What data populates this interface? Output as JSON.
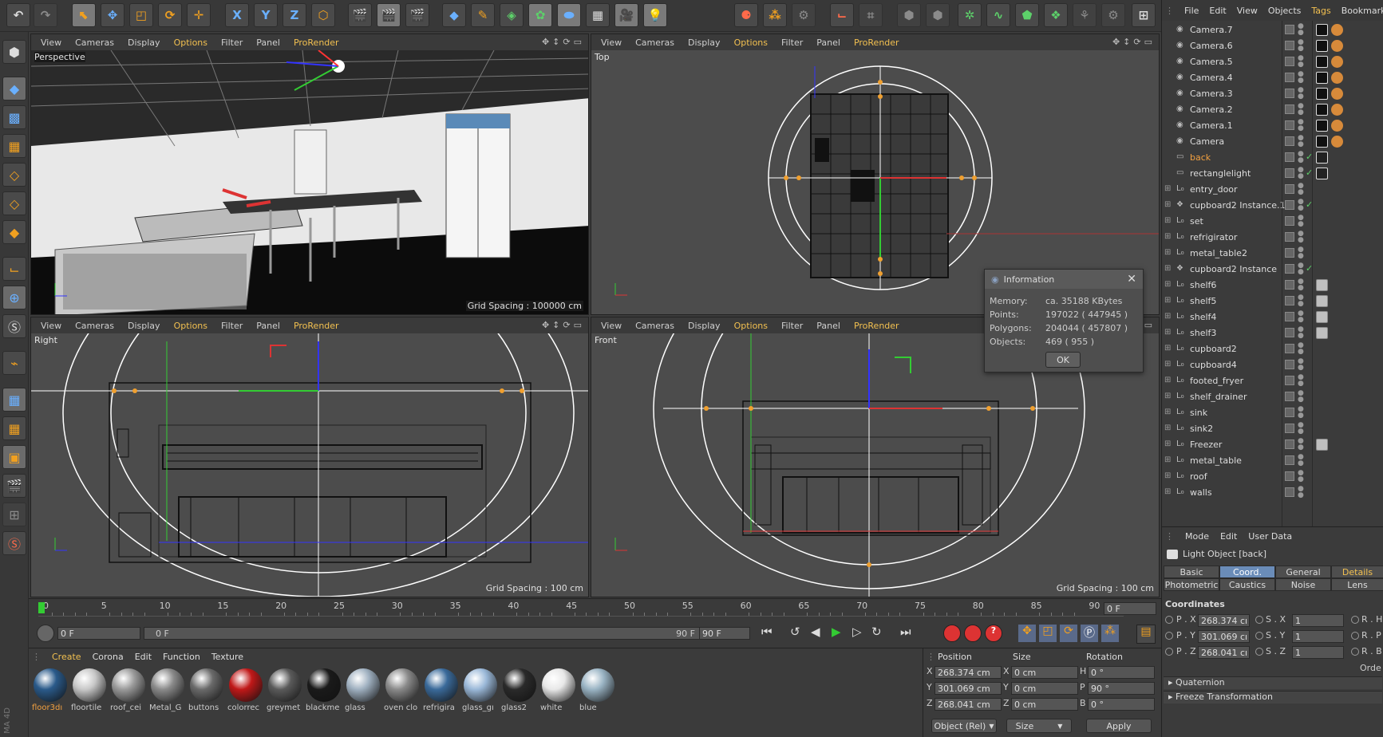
{
  "toolbar": {
    "axis_x": "X",
    "axis_y": "Y",
    "axis_z": "Z"
  },
  "viewports": [
    {
      "menu": [
        "View",
        "Cameras",
        "Display",
        "Options",
        "Filter",
        "Panel",
        "ProRender"
      ],
      "label": "Perspective",
      "grid": "Grid Spacing : 100000 cm"
    },
    {
      "menu": [
        "View",
        "Cameras",
        "Display",
        "Options",
        "Filter",
        "Panel",
        "ProRender"
      ],
      "label": "Top",
      "grid": "Grid Spacing : 100 cm"
    },
    {
      "menu": [
        "View",
        "Cameras",
        "Display",
        "Options",
        "Filter",
        "Panel",
        "ProRender"
      ],
      "label": "Right",
      "grid": "Grid Spacing : 100 cm"
    },
    {
      "menu": [
        "View",
        "Cameras",
        "Display",
        "Options",
        "Filter",
        "Panel",
        "ProRender"
      ],
      "label": "Front",
      "grid": "Grid Spacing : 100 cm"
    }
  ],
  "info_dialog": {
    "title": "Information",
    "rows": [
      {
        "label": "Memory:",
        "value": "ca. 35188 KBytes"
      },
      {
        "label": "Points:",
        "value": "197022 ( 447945 )"
      },
      {
        "label": "Polygons:",
        "value": "204044 ( 457807 )"
      },
      {
        "label": "Objects:",
        "value": "469 ( 955 )"
      }
    ],
    "ok": "OK"
  },
  "object_manager": {
    "menu": [
      "File",
      "Edit",
      "View",
      "Objects",
      "Tags",
      "Bookmarks"
    ],
    "objects": [
      "Camera.7",
      "Camera.6",
      "Camera.5",
      "Camera.4",
      "Camera.3",
      "Camera.2",
      "Camera.1",
      "Camera",
      "back",
      "rectanglelight",
      "entry_door",
      "cupboard2 Instance.1",
      "set",
      "refrigirator",
      "metal_table2",
      "cupboard2 Instance",
      "shelf6",
      "shelf5",
      "shelf4",
      "shelf3",
      "cupboard2",
      "cupboard4",
      "footed_fryer",
      "shelf_drainer",
      "sink",
      "sink2",
      "Freezer",
      "metal_table",
      "roof",
      "walls"
    ]
  },
  "attributes": {
    "menu": [
      "Mode",
      "Edit",
      "User Data"
    ],
    "object": "Light Object [back]",
    "tabs_row1": [
      "Basic",
      "Coord.",
      "General",
      "Details"
    ],
    "tabs_row2": [
      "Photometric",
      "Caustics",
      "Noise",
      "Lens"
    ],
    "section": "Coordinates",
    "p_labels": [
      "P . X",
      "P . Y",
      "P . Z"
    ],
    "p_values": [
      "268.374 cı",
      "301.069 cı",
      "268.041 cı"
    ],
    "s_labels": [
      "S . X",
      "S . Y",
      "S . Z"
    ],
    "s_values": [
      "1",
      "1",
      "1"
    ],
    "r_labels": [
      "R . H",
      "R . P",
      "R . B"
    ],
    "order": "Orde",
    "quaternion": "Quaternion",
    "freeze": "Freeze Transformation"
  },
  "timeline": {
    "ticks": [
      "0",
      "5",
      "10",
      "15",
      "20",
      "25",
      "30",
      "35",
      "40",
      "45",
      "50",
      "55",
      "60",
      "65",
      "70",
      "75",
      "80",
      "85",
      "90"
    ],
    "frame_end": "0 F",
    "current": "0 F",
    "range_start": "0 F",
    "range_end": "90 F",
    "max": "90 F"
  },
  "materials": {
    "menu": [
      "Create",
      "Corona",
      "Edit",
      "Function",
      "Texture"
    ],
    "items": [
      {
        "name": "floor3dı",
        "color": "#2a5a8a"
      },
      {
        "name": "floortile",
        "color": "#c8c8c8"
      },
      {
        "name": "roof_cei",
        "color": "#9a9a9a"
      },
      {
        "name": "Metal_G",
        "color": "#8a8a8a"
      },
      {
        "name": "buttons",
        "color": "#6a6a6a"
      },
      {
        "name": "colorrec",
        "color": "#c01818"
      },
      {
        "name": "greymet",
        "color": "#5a5a5a"
      },
      {
        "name": "blackme",
        "color": "#1a1a1a"
      },
      {
        "name": "glass",
        "color": "#9fb0c0"
      },
      {
        "name": "oven clo",
        "color": "#8a8a8a"
      },
      {
        "name": "refrigira",
        "color": "#3a6a9a"
      },
      {
        "name": "glass_gı",
        "color": "#9ab8d8"
      },
      {
        "name": "glass2",
        "color": "#2a2a2a"
      },
      {
        "name": "white",
        "color": "#e8e8e8"
      },
      {
        "name": "blue",
        "color": "#9ab4c4"
      }
    ]
  },
  "coord_manager": {
    "headers": [
      "Position",
      "Size",
      "Rotation"
    ],
    "rows": [
      {
        "a": "X",
        "pos": "268.374 cm",
        "b": "X",
        "size": "0 cm",
        "c": "H",
        "rot": "0 °"
      },
      {
        "a": "Y",
        "pos": "301.069 cm",
        "b": "Y",
        "size": "0 cm",
        "c": "P",
        "rot": "90 °"
      },
      {
        "a": "Z",
        "pos": "268.041 cm",
        "b": "Z",
        "size": "0 cm",
        "c": "B",
        "rot": "0 °"
      }
    ],
    "mode": "Object (Rel)",
    "size_mode": "Size",
    "apply": "Apply"
  },
  "side_label": "MA 4D"
}
